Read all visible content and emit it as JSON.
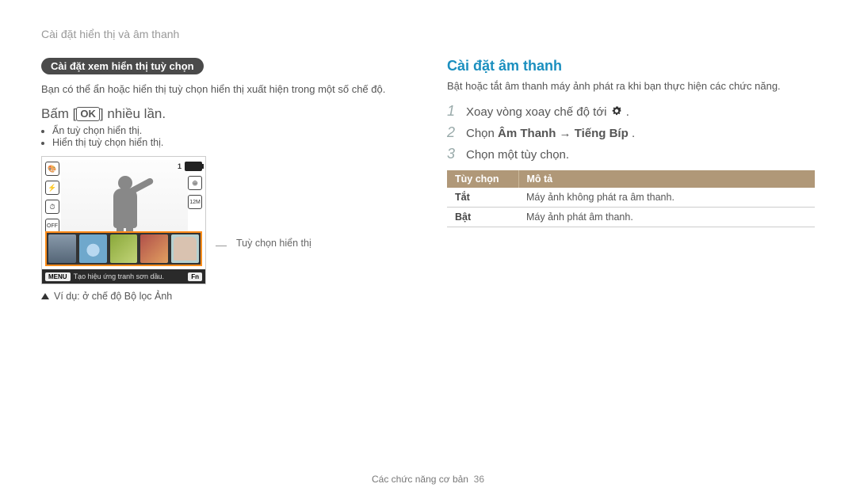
{
  "breadcrumb": "Cài đặt hiển thị và âm thanh",
  "left": {
    "pill": "Cài đặt xem hiển thị tuỳ chọn",
    "intro": "Bạn có thể ẩn hoặc hiển thị tuỳ chọn hiển thị xuất hiện trong một số chế độ.",
    "press_prefix": "Bấm [",
    "press_ok": "OK",
    "press_suffix": "] nhiều lần.",
    "bullets": [
      "Ẩn tuỳ chọn hiển thị.",
      "Hiển thị tuỳ chọn hiển thị."
    ],
    "screenshot": {
      "count_label": "1",
      "menu_chip": "MENU",
      "fn_chip": "Fn",
      "status_text": "Tạo hiệu ứng tranh sơn dầu."
    },
    "callout": "Tuỳ chọn hiển thị",
    "example": "Ví dụ: ở chế độ Bộ lọc Ảnh"
  },
  "right": {
    "heading": "Cài đặt âm thanh",
    "intro": "Bật hoặc tắt âm thanh máy ảnh phát ra khi bạn thực hiện các chức năng.",
    "steps": [
      {
        "text_before": "Xoay vòng xoay chế độ tới ",
        "icon": "gear",
        "text_after": "."
      },
      {
        "text_before": "Chọn ",
        "strong": "Âm Thanh → Tiếng Bíp",
        "text_after": "."
      },
      {
        "text_before": "Chọn một tùy chọn."
      }
    ],
    "table": {
      "head": [
        "Tùy chọn",
        "Mô tả"
      ],
      "rows": [
        [
          "Tắt",
          "Máy ảnh không phát ra âm thanh."
        ],
        [
          "Bật",
          "Máy ảnh phát âm thanh."
        ]
      ]
    }
  },
  "footer": {
    "section": "Các chức năng cơ bản",
    "page": "36"
  }
}
